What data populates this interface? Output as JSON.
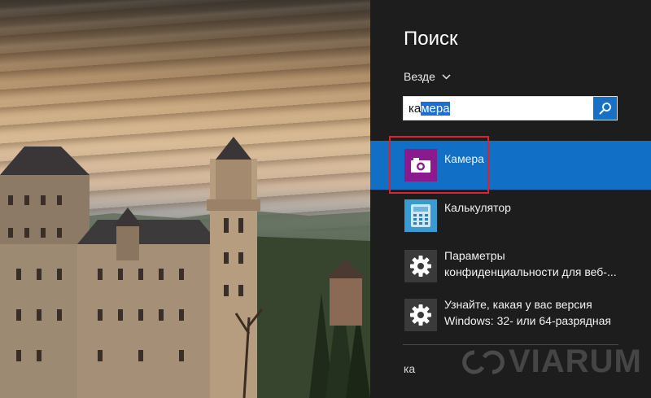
{
  "search_panel": {
    "title": "Поиск",
    "scope_label": "Везде",
    "search": {
      "typed_prefix": "ка",
      "selected_suffix": "мера"
    },
    "results": [
      {
        "label": "Камера",
        "icon": "camera-icon",
        "selected": true
      },
      {
        "label": "Калькулятор",
        "icon": "calculator-icon",
        "selected": false
      },
      {
        "label_line1": "Параметры",
        "label_line2": "конфиденциальности для веб-...",
        "icon": "gear-icon",
        "selected": false
      },
      {
        "label_line1": "Узнайте, какая у вас версия",
        "label_line2": "Windows: 32- или 64-разрядная",
        "icon": "gear-icon",
        "selected": false
      }
    ],
    "suggestion": "ка"
  },
  "watermark": "VIARUM",
  "colors": {
    "panel_background": "#1d1d1d",
    "selected_result": "#1170c6",
    "search_button": "#1870c4",
    "camera_tile": "#8b1a8f",
    "highlight_border": "#e0202a"
  }
}
